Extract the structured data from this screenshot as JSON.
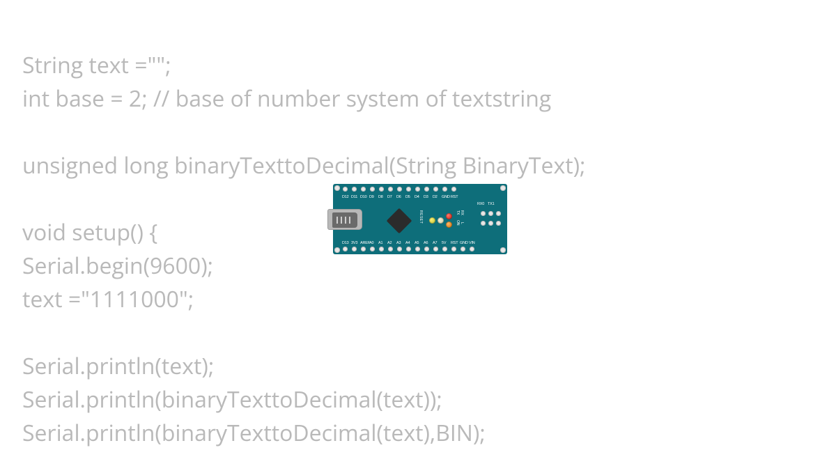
{
  "code_lines": [
    "String text =\"\";",
    "int base = 2; // base of number system of textstring",
    "",
    "unsigned long binaryTexttoDecimal(String BinaryText);",
    "",
    "void setup() {",
    "Serial.begin(9600);",
    "text =\"1111000\";",
    "",
    "Serial.println(text);",
    "Serial.println(binaryTexttoDecimal(text));",
    "Serial.println(binaryTexttoDecimal(text),BIN);"
  ],
  "board": {
    "name": "arduino-nano",
    "colors": {
      "pcb": "#0e6e7a",
      "silk": "#ffffff"
    },
    "top_pins": [
      "D12",
      "D11",
      "D10",
      "D9",
      "D8",
      "D7",
      "D6",
      "D5",
      "D4",
      "D3",
      "D2",
      "GND",
      "RST"
    ],
    "bottom_pins": [
      "D13",
      "3V3",
      "AREF",
      "A0",
      "A1",
      "A2",
      "A3",
      "A4",
      "A5",
      "A6",
      "A7",
      "5V",
      "RST",
      "GND",
      "VIN"
    ],
    "right_labels": [
      "RX0",
      "TX1"
    ],
    "reset_label": "RESET",
    "led_labels": [
      "TX",
      "RX",
      "ON",
      "L"
    ]
  }
}
